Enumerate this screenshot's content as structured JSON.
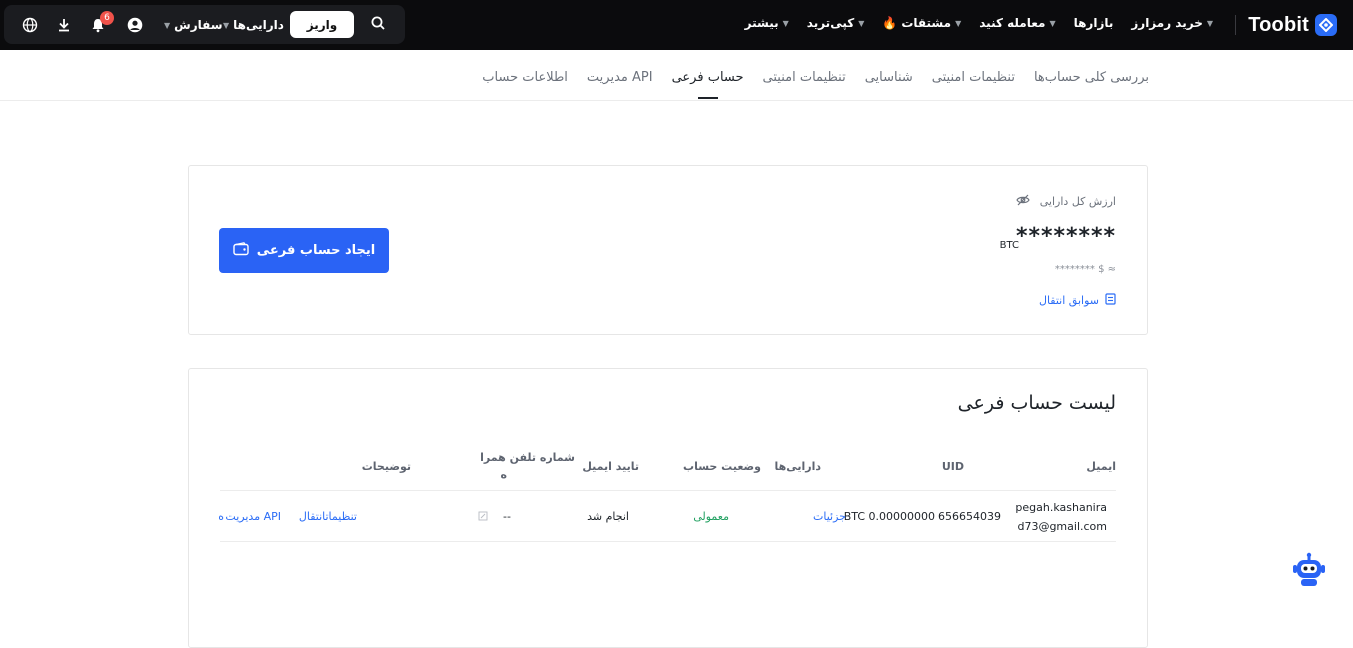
{
  "brand": {
    "name": "Toobit",
    "accent": "#2a63f5"
  },
  "topnav": {
    "items": [
      {
        "label": "خرید رمزارز",
        "caret": true
      },
      {
        "label": "بازارها",
        "caret": false
      },
      {
        "label": "معامله کنید",
        "caret": true
      },
      {
        "label": "مشتقات",
        "caret": true,
        "icon": "fire-icon"
      },
      {
        "label": "کپی‌ترید",
        "caret": true
      },
      {
        "label": "بیشتر",
        "caret": true
      }
    ]
  },
  "toolbar": {
    "deposit_label": "واریز",
    "assets_label": "دارایی‌ها",
    "orders_label": "سفارش",
    "notification_count": "6",
    "icons": [
      "search-icon",
      "user-icon",
      "bell-icon",
      "download-icon",
      "globe-icon"
    ]
  },
  "subnav": {
    "tabs": [
      {
        "label": "بررسی کلی حساب‌ها",
        "active": false
      },
      {
        "label": "تنظیمات امنیتی",
        "active": false
      },
      {
        "label": "شناسایی",
        "active": false
      },
      {
        "label": "تنظیمات امنیتی",
        "active": false
      },
      {
        "label": "حساب فرعی",
        "active": true
      },
      {
        "label": "مدیریت API",
        "active": false
      },
      {
        "label": "اطلاعات حساب",
        "active": false
      }
    ]
  },
  "summary": {
    "total_label": "ارزش کل دارایی",
    "masked_value": "********",
    "unit": "BTC",
    "approx_value": "≈ $ ********",
    "history_link": "سوابق انتقال",
    "create_button": "ایجاد حساب فرعی"
  },
  "subaccounts": {
    "title": "لیست حساب فرعی",
    "columns": {
      "email": "ایمیل",
      "uid": "UID",
      "assets": "دارایی‌ها",
      "status": "وضعیت حساب",
      "email_verify": "تایید ایمیل",
      "phone_line1": "شماره تلفن همرا",
      "phone_line2": "ه",
      "notes": "توضیحات"
    },
    "rows": [
      {
        "email_line1": "pegah.kashanira",
        "email_line2": "d73@gmail.com",
        "uid": "656654039",
        "assets_value": "BTC 0.00000000",
        "assets_link": "جزئیات",
        "status": "معمولی",
        "email_verify": "انجام شد",
        "phone": "--",
        "action_transfer": "تنظیماتانتقال",
        "action_api": "مدیریت API",
        "action_more": "ه"
      }
    ]
  }
}
